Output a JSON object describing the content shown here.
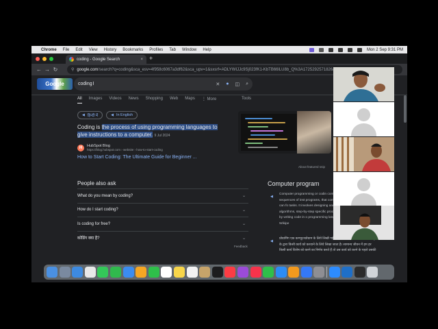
{
  "menubar": {
    "app_name": "Chrome",
    "items": [
      "File",
      "Edit",
      "View",
      "History",
      "Bookmarks",
      "Profiles",
      "Tab",
      "Window",
      "Help"
    ],
    "datetime": "Mon 2 Sep  9:31 PM"
  },
  "browser": {
    "tab_title": "coding - Google Search",
    "tab_close": "×",
    "new_tab": "+",
    "url_host": "google.com",
    "url_rest": "/search?q=coding&sca_esv=4f958c6067a3df62&sca_upv=1&sxsrf=ADLYWIJJc9Sj023fK1-KbTB66lLU8b_Q%3A1725292571826&ei=G-DV"
  },
  "google": {
    "logo_text": "Google",
    "query": "coding",
    "nav_tabs": [
      "All",
      "Images",
      "Videos",
      "News",
      "Shopping",
      "Web",
      "Maps",
      "⋮ More"
    ],
    "tools": "Tools",
    "chips": [
      "हिन्दी में",
      "In English"
    ],
    "snippet": {
      "prefix": "Coding is ",
      "highlight": "the process of using programming languages to give instructions to a computer.",
      "date": "9 Jul 2024"
    },
    "source_name": "HubSpot Blog",
    "source_url": "https://blog.hubspot.com › website › how-to-start-coding",
    "source_favicon": "H",
    "result_title": "How to Start Coding: The Ultimate Guide for Beginner ...",
    "about_featured": "About featured snip",
    "paa_title": "People also ask",
    "paa_questions": [
      "What do you mean by coding?",
      "How do I start coding?",
      "Is coding for free?",
      "कोडिंग क्या है?"
    ],
    "feedback": "Feedback",
    "kp_title": "Computer program",
    "kp_text": "Computer programming or codin compilation of sequences of inst programs, that computers can fo tasks. It involves designing and algorithms, step-by-step specific procedures, by writing code in o programming languages. Wikipe",
    "kp_text_hindi": "प्रोग्रामिंग एक कम्प्यूटरप्रोग्राम के लिये लिखी गई क्रियाविधि प्रक्रिया है। प्रोग्राम कम्प्यूटर के द्वारा किसी कार्य को करवाने के लिये लिखा जाता है। सामान्य जीवन में हम हर किसी कार्य विशेष को करने का निर्णय करते हैं तो उस कार्य को करने के पहले उसकी"
  },
  "dock_apps": [
    {
      "name": "finder-icon",
      "color": "#4a90e2"
    },
    {
      "name": "launchpad-icon",
      "color": "#7a8aa0"
    },
    {
      "name": "safari-icon",
      "color": "#3d8ae0"
    },
    {
      "name": "chrome-icon",
      "color": "#e8e8e8"
    },
    {
      "name": "messages-icon",
      "color": "#34c759"
    },
    {
      "name": "facetime-icon",
      "color": "#30b94d"
    },
    {
      "name": "mail-icon",
      "color": "#3b8cf0"
    },
    {
      "name": "photos-icon",
      "color": "#f5a623"
    },
    {
      "name": "facetime-video-icon",
      "color": "#2fbf4a"
    },
    {
      "name": "calendar-icon",
      "color": "#ffffff"
    },
    {
      "name": "notes-icon",
      "color": "#f7d54a"
    },
    {
      "name": "reminders-icon",
      "color": "#f2f2f2"
    },
    {
      "name": "freeform-icon",
      "color": "#c7a46a"
    },
    {
      "name": "appletv-icon",
      "color": "#1c1c1e"
    },
    {
      "name": "music-icon",
      "color": "#fc3c44"
    },
    {
      "name": "podcasts-icon",
      "color": "#9b4bd8"
    },
    {
      "name": "news-icon",
      "color": "#f7334b"
    },
    {
      "name": "numbers-icon",
      "color": "#2fbf4a"
    },
    {
      "name": "appstore-icon",
      "color": "#2c8cf4"
    },
    {
      "name": "pages-icon",
      "color": "#f39a1e"
    },
    {
      "name": "keynote-icon",
      "color": "#3478f6"
    },
    {
      "name": "settings-icon",
      "color": "#8e8e93"
    },
    {
      "name": "zoom-icon",
      "color": "#2d8cff"
    },
    {
      "name": "vscode-icon",
      "color": "#1f6fc7"
    },
    {
      "name": "terminal-icon",
      "color": "#2b2b2b"
    },
    {
      "name": "trash-icon",
      "color": "#d0d4d8"
    }
  ],
  "colors": {
    "page_bg": "#202124",
    "link": "#8ab4f8",
    "highlight": "#2f4f86"
  }
}
